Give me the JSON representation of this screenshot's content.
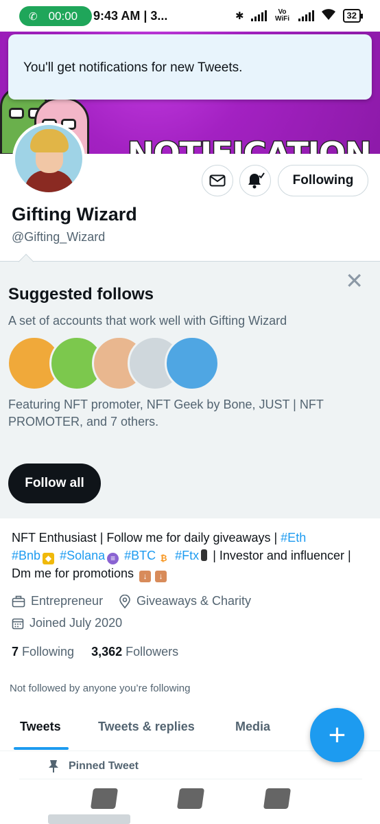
{
  "status_bar": {
    "call_time": "00:00",
    "time": "9:43 AM | 3...",
    "network": "Vo WiFi",
    "battery": "32"
  },
  "toast": {
    "message": "You'll get notifications for new Tweets."
  },
  "banner": {
    "text": "NOTIFICATION ON !"
  },
  "profile": {
    "name": "Gifting Wizard",
    "handle": "@Gifting_Wizard",
    "following_button": "Following",
    "mail_icon": "envelope-icon",
    "bell_icon": "bell-check-icon"
  },
  "suggested": {
    "title": "Suggested follows",
    "subtitle": "A set of accounts that work well with Gifting Wizard",
    "featuring": "Featuring NFT promoter, NFT Geek by Bone, JUST | NFT PROMOTER, and 7 others.",
    "follow_all": "Follow all",
    "close_icon": "close-icon",
    "avatar_colors": [
      "#f0a93a",
      "#7cc84d",
      "#e9b78f",
      "#cfd7dc",
      "#4fa6e3"
    ]
  },
  "bio": {
    "p1": "NFT Enthusiast | Follow me for daily giveaways  | ",
    "tag_eth": "#Eth",
    "tag_bnb": "#Bnb",
    "tag_solana": "#Solana",
    "tag_btc": "#BTC",
    "tag_ftx": "#Ftx",
    "p2": " | Investor and influencer |  Dm me for promotions"
  },
  "meta": {
    "category": "Entrepreneur",
    "location": "Giveaways & Charity",
    "joined": "Joined July 2020"
  },
  "counts": {
    "following_num": "7",
    "following_label": "Following",
    "followers_num": "3,362",
    "followers_label": "Followers"
  },
  "not_followed": "Not followed by anyone you’re following",
  "tabs": [
    "Tweets",
    "Tweets & replies",
    "Media"
  ],
  "active_tab": "Tweets",
  "pinned": "Pinned Tweet",
  "fab_label": "+",
  "colors": {
    "accent": "#1d9bf0",
    "banner": "#a321c2",
    "text": "#0f1419",
    "muted": "#536471"
  }
}
